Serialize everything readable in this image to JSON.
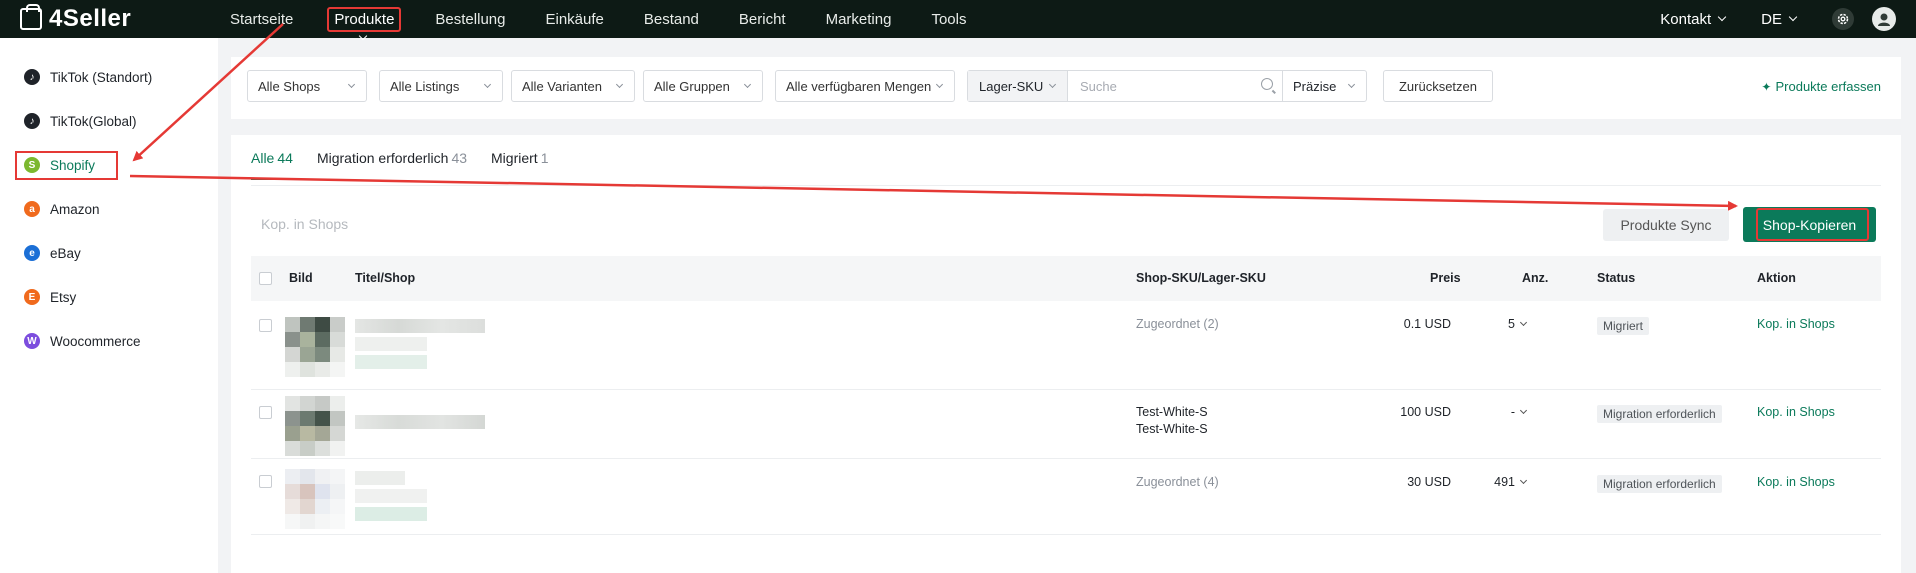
{
  "brand": {
    "name": "4Seller"
  },
  "nav": {
    "items": [
      "Startseite",
      "Produkte",
      "Bestellung",
      "Einkäufe",
      "Bestand",
      "Bericht",
      "Marketing",
      "Tools"
    ],
    "active": "Produkte",
    "contact": "Kontakt",
    "language": "DE"
  },
  "sidebar": {
    "items": [
      {
        "label": "TikTok (Standort)",
        "icon": "tiktok-icon",
        "color": "#1f2329"
      },
      {
        "label": "TikTok(Global)",
        "icon": "tiktok-icon",
        "color": "#1f2329"
      },
      {
        "label": "Shopify",
        "icon": "shopify-icon",
        "color": "#7cb82f"
      },
      {
        "label": "Amazon",
        "icon": "amazon-icon",
        "color": "#f06a1d"
      },
      {
        "label": "eBay",
        "icon": "ebay-icon",
        "color": "#1b6fd6"
      },
      {
        "label": "Etsy",
        "icon": "etsy-icon",
        "color": "#f06a1d"
      },
      {
        "label": "Woocommerce",
        "icon": "woocommerce-icon",
        "color": "#7c4dde"
      }
    ],
    "active": "Shopify"
  },
  "filters": {
    "shops": "Alle Shops",
    "listings": "Alle Listings",
    "variants": "Alle Varianten",
    "groups": "Alle Gruppen",
    "quantities": "Alle verfügbaren Mengen",
    "search_field": "Lager-SKU",
    "search_placeholder": "Suche",
    "match_mode": "Präzise",
    "reset": "Zurücksetzen",
    "add_products": "Produkte erfassen"
  },
  "tabs": [
    {
      "label": "Alle",
      "count": "44"
    },
    {
      "label": "Migration erforderlich",
      "count": "43"
    },
    {
      "label": "Migriert",
      "count": "1"
    }
  ],
  "bulk": {
    "copy_to_shops": "Kop. in Shops",
    "sync": "Produkte Sync",
    "shop_copy": "Shop-Kopieren"
  },
  "table": {
    "headers": {
      "image": "Bild",
      "title": "Titel/Shop",
      "sku": "Shop-SKU/Lager-SKU",
      "price": "Preis",
      "qty": "Anz.",
      "status": "Status",
      "action": "Aktion"
    },
    "rows": [
      {
        "sku_line1": "Zugeordnet (2)",
        "sku_line2": "",
        "sku_muted": true,
        "price": "0.1 USD",
        "qty": "5",
        "status": "Migriert",
        "action": "Kop. in Shops"
      },
      {
        "sku_line1": "Test-White-S",
        "sku_line2": "Test-White-S",
        "sku_muted": false,
        "price": "100 USD",
        "qty": "-",
        "status": "Migration erforderlich",
        "action": "Kop. in Shops"
      },
      {
        "sku_line1": "Zugeordnet (4)",
        "sku_line2": "",
        "sku_muted": true,
        "price": "30 USD",
        "qty": "491",
        "status": "Migration erforderlich",
        "action": "Kop. in Shops"
      }
    ]
  },
  "colors": {
    "accent": "#0b7a5a",
    "topbar": "#0d1a15",
    "annotation": "#e53935"
  }
}
